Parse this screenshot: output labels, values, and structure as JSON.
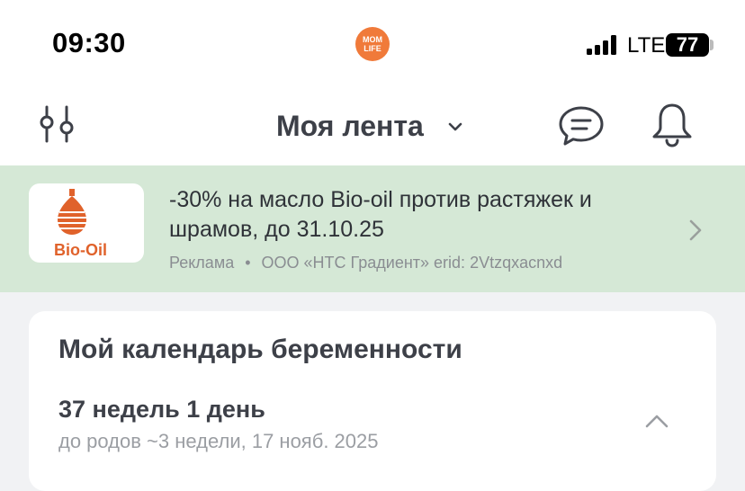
{
  "status_bar": {
    "time": "09:30",
    "app_logo_text": "MOM LIFE",
    "network": "LTE",
    "battery": "77"
  },
  "header": {
    "title": "Моя лента",
    "icons": [
      "filter-icon",
      "chevron-down-icon",
      "chat-icon",
      "bell-icon"
    ]
  },
  "ad": {
    "brand": "Bio-Oil",
    "title": "-30% на масло Bio-oil против растяжек и шрамов, до 31.10.25",
    "label": "Реклама",
    "separator": "•",
    "advertiser": "ООО «НТС Градиент» erid: 2Vtzqxacnxd"
  },
  "calendar": {
    "title": "Мой календарь беременности",
    "week": "37 недель 1 день",
    "due": "до родов ~3 недели, 17 нояб. 2025"
  },
  "colors": {
    "accent": "#f07a3a",
    "ad_background": "#d5e8d6",
    "page_background": "#f1f2f4",
    "text": "#3d4048"
  }
}
